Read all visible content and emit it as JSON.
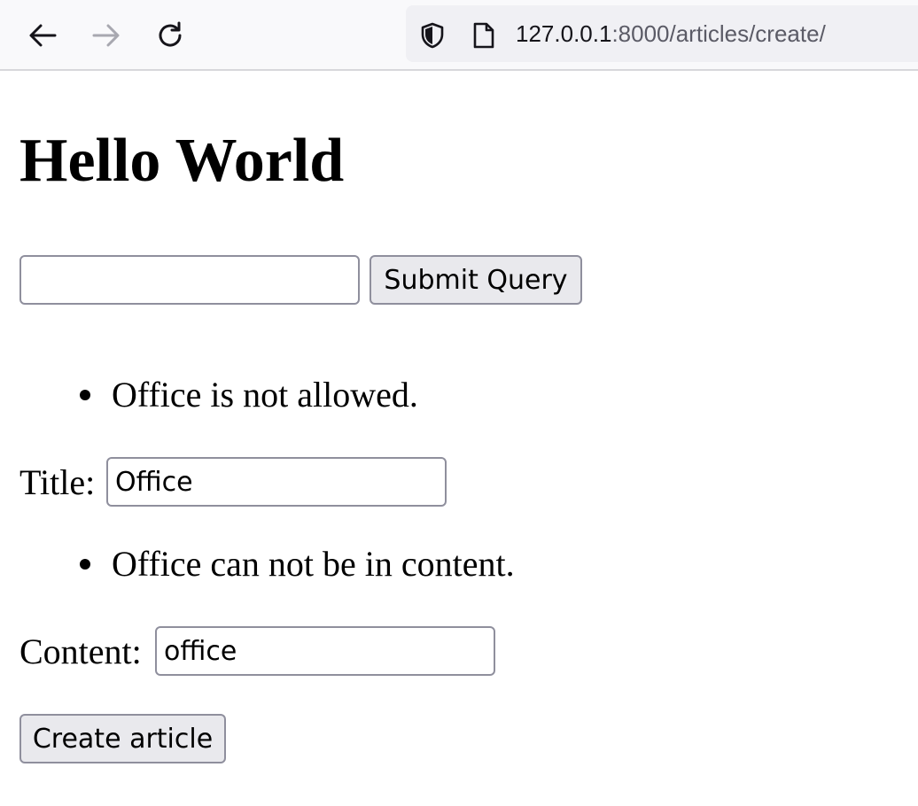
{
  "browser": {
    "url_host": "127.0.0.1",
    "url_path": ":8000/articles/create/"
  },
  "page": {
    "heading": "Hello World",
    "search": {
      "value": "",
      "submit_label": "Submit Query"
    },
    "form": {
      "title_error": "Office is not allowed.",
      "title_label": "Title:",
      "title_value": "Office",
      "content_error": "Office can not be in content.",
      "content_label": "Content:",
      "content_value": "office",
      "submit_label": "Create article"
    }
  },
  "icons": {
    "back": "back-arrow-icon",
    "forward": "forward-arrow-icon",
    "reload": "reload-icon",
    "shield": "shield-icon",
    "page": "page-icon"
  },
  "colors": {
    "toolbar_bg": "#f9f9fb",
    "urlbar_bg": "#f0f0f4",
    "button_bg": "#e9e9ed",
    "border": "#8f8f9d"
  }
}
